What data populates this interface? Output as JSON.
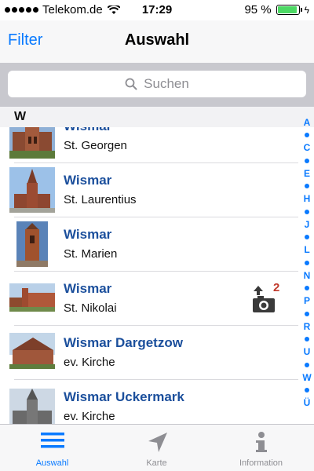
{
  "status_bar": {
    "carrier": "Telekom.de",
    "time": "17:29",
    "battery_percent": "95 %",
    "battery_level": 0.95
  },
  "nav": {
    "filter_label": "Filter",
    "title": "Auswahl"
  },
  "search": {
    "placeholder": "Suchen"
  },
  "section": {
    "letter": "W"
  },
  "items": [
    {
      "title": "Wismar",
      "subtitle": "St. Georgen"
    },
    {
      "title": "Wismar",
      "subtitle": "St. Laurentius"
    },
    {
      "title": "Wismar",
      "subtitle": "St. Marien"
    },
    {
      "title": "Wismar",
      "subtitle": "St. Nikolai",
      "upload_count": "2"
    },
    {
      "title": "Wismar Dargetzow",
      "subtitle": "ev. Kirche"
    },
    {
      "title": "Wismar Uckermark",
      "subtitle": "ev. Kirche"
    }
  ],
  "index": [
    "A",
    "C",
    "E",
    "H",
    "J",
    "L",
    "N",
    "P",
    "R",
    "U",
    "W",
    "Ü"
  ],
  "tabs": [
    {
      "label": "Auswahl",
      "icon": "list-icon",
      "active": true
    },
    {
      "label": "Karte",
      "icon": "location-arrow-icon",
      "active": false
    },
    {
      "label": "Information",
      "icon": "info-icon",
      "active": false
    }
  ],
  "colors": {
    "accent": "#0a7aff",
    "title_blue": "#1b4f9c",
    "badge_red": "#c0392b",
    "battery_green": "#4cd964"
  }
}
